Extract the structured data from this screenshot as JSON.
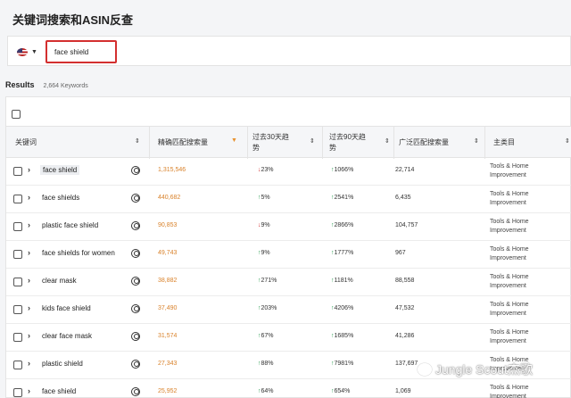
{
  "page": {
    "title": "关键词搜索和ASIN反查"
  },
  "search": {
    "country_icon": "us-flag-icon",
    "value": "face shield"
  },
  "results": {
    "label": "Results",
    "count": "2,664 Keywords"
  },
  "table": {
    "headers": [
      {
        "key": "keyword",
        "line1": "关键词",
        "line2": ""
      },
      {
        "key": "exact",
        "line1": "精确匹配搜索量",
        "line2": ""
      },
      {
        "key": "trend30",
        "line1": "过去30天趋",
        "line2": "势"
      },
      {
        "key": "trend90",
        "line1": "过去90天趋",
        "line2": "势"
      },
      {
        "key": "broad",
        "line1": "广泛匹配搜索量",
        "line2": ""
      },
      {
        "key": "category",
        "line1": "主类目",
        "line2": ""
      }
    ],
    "rows": [
      {
        "keyword": "face shield",
        "exact": "1,315,546",
        "t30": "23%",
        "t30_dir": "down",
        "t90": "1066%",
        "t90_dir": "up",
        "broad": "22,714",
        "cat1": "Tools & Home",
        "cat2": "Improvement"
      },
      {
        "keyword": "face shields",
        "exact": "440,682",
        "t30": "5%",
        "t30_dir": "up",
        "t90": "2541%",
        "t90_dir": "up",
        "broad": "6,435",
        "cat1": "Tools & Home",
        "cat2": "Improvement"
      },
      {
        "keyword": "plastic face shield",
        "exact": "90,853",
        "t30": "9%",
        "t30_dir": "down",
        "t90": "2866%",
        "t90_dir": "up",
        "broad": "104,757",
        "cat1": "Tools & Home",
        "cat2": "Improvement"
      },
      {
        "keyword": "face shields for women",
        "exact": "49,743",
        "t30": "9%",
        "t30_dir": "up",
        "t90": "1777%",
        "t90_dir": "up",
        "broad": "967",
        "cat1": "Tools & Home",
        "cat2": "Improvement"
      },
      {
        "keyword": "clear mask",
        "exact": "38,882",
        "t30": "271%",
        "t30_dir": "up",
        "t90": "1181%",
        "t90_dir": "up",
        "broad": "88,558",
        "cat1": "Tools & Home",
        "cat2": "Improvement"
      },
      {
        "keyword": "kids face shield",
        "exact": "37,490",
        "t30": "203%",
        "t30_dir": "up",
        "t90": "4206%",
        "t90_dir": "up",
        "broad": "47,532",
        "cat1": "Tools & Home",
        "cat2": "Improvement"
      },
      {
        "keyword": "clear face mask",
        "exact": "31,574",
        "t30": "67%",
        "t30_dir": "up",
        "t90": "1685%",
        "t90_dir": "up",
        "broad": "41,286",
        "cat1": "Tools & Home",
        "cat2": "Improvement"
      },
      {
        "keyword": "plastic shield",
        "exact": "27,343",
        "t30": "88%",
        "t30_dir": "up",
        "t90": "7981%",
        "t90_dir": "up",
        "broad": "137,697",
        "cat1": "Tools & Home",
        "cat2": "Improvement"
      },
      {
        "keyword": "face shield",
        "exact": "25,952",
        "t30": "64%",
        "t30_dir": "up",
        "t90": "654%",
        "t90_dir": "up",
        "broad": "1,069",
        "cat1": "Tools & Home",
        "cat2": "Improvement"
      }
    ]
  },
  "watermark": {
    "text": "Jungle Scout杰歌"
  },
  "colors": {
    "highlight_border": "#d32f2f",
    "exact_value": "#d9822b",
    "trend_up": "#2e9e55",
    "trend_down": "#d32f2f",
    "sort_active": "#e8912d"
  }
}
